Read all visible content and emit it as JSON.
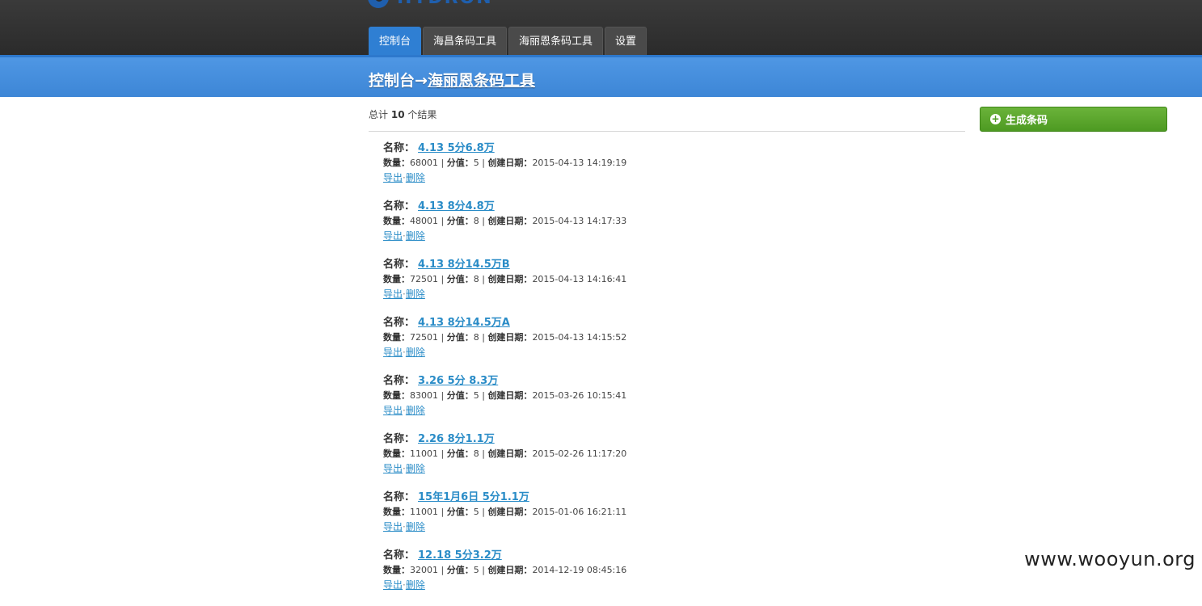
{
  "header": {
    "logo_text": "HYDRON",
    "tabs": [
      {
        "label": "控制台",
        "active": true
      },
      {
        "label": "海昌条码工具",
        "active": false
      },
      {
        "label": "海丽恩条码工具",
        "active": false
      },
      {
        "label": "设置",
        "active": false
      }
    ]
  },
  "breadcrumb": {
    "root": "控制台",
    "arrow": "→",
    "current": "海丽恩条码工具"
  },
  "summary": {
    "prefix": "总计",
    "count": "10",
    "suffix": "个结果"
  },
  "generate_button": {
    "label": "生成条码",
    "icon": "plus-circle-icon"
  },
  "labels": {
    "name": "名称：",
    "quantity": "数量：",
    "value": "分值：",
    "created": "创建日期：",
    "export": "导出",
    "delete": "删除",
    "sep": "|",
    "dot": "·"
  },
  "items": [
    {
      "name": "4.13 5分6.8万",
      "quantity": "68001",
      "value": "5",
      "created": "2015-04-13 14:19:19"
    },
    {
      "name": "4.13 8分4.8万",
      "quantity": "48001",
      "value": "8",
      "created": "2015-04-13 14:17:33"
    },
    {
      "name": "4.13 8分14.5万B",
      "quantity": "72501",
      "value": "8",
      "created": "2015-04-13 14:16:41"
    },
    {
      "name": "4.13 8分14.5万A",
      "quantity": "72501",
      "value": "8",
      "created": "2015-04-13 14:15:52"
    },
    {
      "name": "3.26 5分 8.3万",
      "quantity": "83001",
      "value": "5",
      "created": "2015-03-26 10:15:41"
    },
    {
      "name": "2.26 8分1.1万",
      "quantity": "11001",
      "value": "8",
      "created": "2015-02-26 11:17:20"
    },
    {
      "name": "15年1月6日 5分1.1万",
      "quantity": "11001",
      "value": "5",
      "created": "2015-01-06 16:21:11"
    },
    {
      "name": "12.18 5分3.2万",
      "quantity": "32001",
      "value": "5",
      "created": "2014-12-19 08:45:16"
    }
  ],
  "watermark": "www.wooyun.org",
  "colors": {
    "accent": "#2f7fd3",
    "link": "#2a8cc7",
    "button": "#5aa62c",
    "header_bg": "#2b2b2b"
  }
}
